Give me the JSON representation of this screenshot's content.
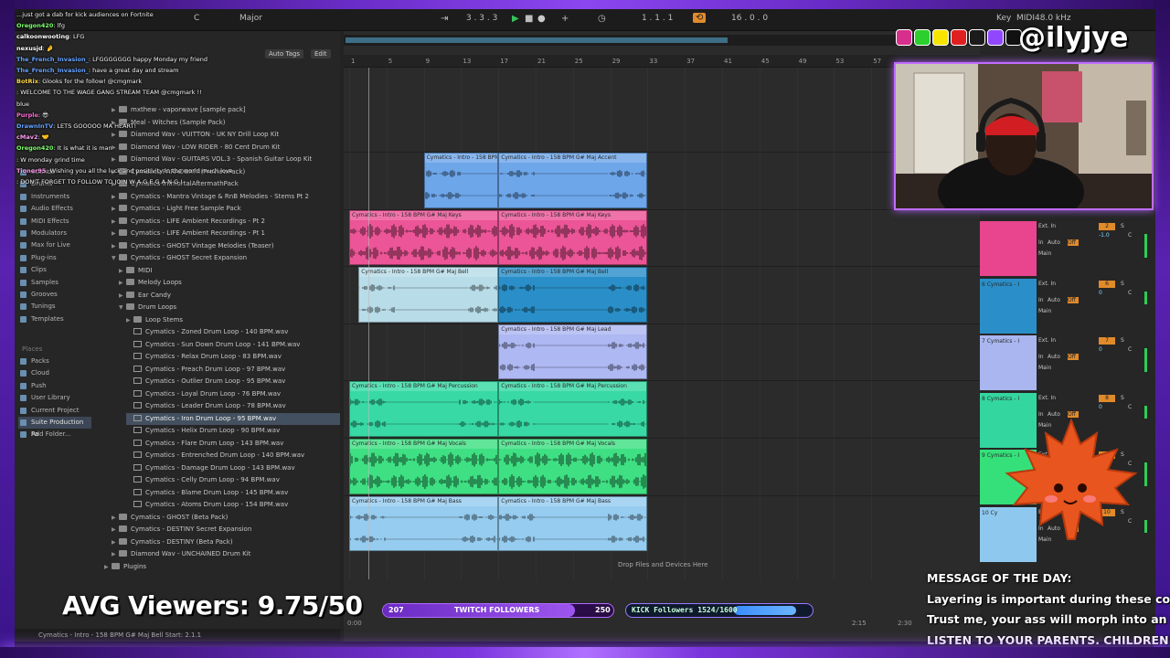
{
  "toolbar": {
    "scale_root": "C",
    "scale_mode": "Major",
    "position": "3 . 3 . 3",
    "loop_start": "1 . 1 . 1",
    "loop_length": "16 . 0 . 0",
    "key_label": "Key",
    "midi_label": "MIDI",
    "sample_rate": "48.0 kHz"
  },
  "browser": {
    "search_header": "Auto Tags",
    "edit_label": "Edit",
    "categories": [
      {
        "label": "Sounds",
        "icon": "speaker-icon"
      },
      {
        "label": "Drums",
        "icon": "drum-icon"
      },
      {
        "label": "Instruments",
        "icon": "keys-icon"
      },
      {
        "label": "Audio Effects",
        "icon": "fx-icon"
      },
      {
        "label": "MIDI Effects",
        "icon": "midi-icon"
      },
      {
        "label": "Modulators",
        "icon": "mod-icon"
      },
      {
        "label": "Max for Live",
        "icon": "max-icon"
      },
      {
        "label": "Plug-ins",
        "icon": "plug-icon"
      },
      {
        "label": "Clips",
        "icon": "clip-icon"
      },
      {
        "label": "Samples",
        "icon": "sample-icon"
      },
      {
        "label": "Grooves",
        "icon": "groove-icon"
      },
      {
        "label": "Tunings",
        "icon": "tuning-icon"
      },
      {
        "label": "Templates",
        "icon": "template-icon"
      }
    ],
    "places_label": "Places",
    "places": [
      {
        "label": "Packs",
        "selected": false
      },
      {
        "label": "Cloud",
        "selected": false
      },
      {
        "label": "Push",
        "selected": false
      },
      {
        "label": "User Library",
        "selected": false
      },
      {
        "label": "Current Project",
        "selected": false
      },
      {
        "label": "Suite Production Pa",
        "selected": true
      },
      {
        "label": "Add Folder...",
        "selected": false
      }
    ],
    "tree": [
      {
        "label": "mxthew - vaporwave [sample pack]",
        "kind": "folder",
        "indent": 0,
        "expanded": false
      },
      {
        "label": "Meal - Witches (Sample Pack)",
        "kind": "folder",
        "indent": 0,
        "expanded": false
      },
      {
        "label": "Diamond Wav - VUITTON - UK NY Drill Loop Kit",
        "kind": "folder",
        "indent": 0,
        "expanded": false
      },
      {
        "label": "Diamond Wav - LOW RIDER - 80 Cent Drum Kit",
        "kind": "folder",
        "indent": 0,
        "expanded": false
      },
      {
        "label": "Diamond Wav - GUITARS VOL.3 - Spanish Guitar Loop Kit",
        "kind": "folder",
        "indent": 0,
        "expanded": false
      },
      {
        "label": "Cymatics-PARADOX!!!(PreviewPack)",
        "kind": "folder",
        "indent": 0,
        "expanded": false
      },
      {
        "label": "Cymatics-ImmortalAftermathPack",
        "kind": "folder",
        "indent": 0,
        "expanded": false
      },
      {
        "label": "Cymatics - Mantra Vintage & RnB Melodies - Stems Pt 2",
        "kind": "folder",
        "indent": 0,
        "expanded": false
      },
      {
        "label": "Cymatics - Light Free Sample Pack",
        "kind": "folder",
        "indent": 0,
        "expanded": false
      },
      {
        "label": "Cymatics - LIFE Ambient Recordings - Pt 2",
        "kind": "folder",
        "indent": 0,
        "expanded": false
      },
      {
        "label": "Cymatics - LIFE Ambient Recordings - Pt 1",
        "kind": "folder",
        "indent": 0,
        "expanded": false
      },
      {
        "label": "Cymatics - GHOST Vintage Melodies (Teaser)",
        "kind": "folder",
        "indent": 0,
        "expanded": false
      },
      {
        "label": "Cymatics - GHOST Secret Expansion",
        "kind": "folder",
        "indent": 0,
        "expanded": true
      },
      {
        "label": "MIDI",
        "kind": "folder",
        "indent": 1,
        "expanded": false
      },
      {
        "label": "Melody Loops",
        "kind": "folder",
        "indent": 1,
        "expanded": false
      },
      {
        "label": "Ear Candy",
        "kind": "folder",
        "indent": 1,
        "expanded": false
      },
      {
        "label": "Drum Loops",
        "kind": "folder",
        "indent": 1,
        "expanded": true
      },
      {
        "label": "Loop Stems",
        "kind": "folder",
        "indent": 2,
        "expanded": false
      },
      {
        "label": "Cymatics - Zoned Drum Loop - 140 BPM.wav",
        "kind": "file",
        "indent": 2,
        "selected": false
      },
      {
        "label": "Cymatics - Sun Down Drum Loop - 141 BPM.wav",
        "kind": "file",
        "indent": 2,
        "selected": false
      },
      {
        "label": "Cymatics - Relax Drum Loop - 83 BPM.wav",
        "kind": "file",
        "indent": 2,
        "selected": false
      },
      {
        "label": "Cymatics - Preach Drum Loop - 97 BPM.wav",
        "kind": "file",
        "indent": 2,
        "selected": false
      },
      {
        "label": "Cymatics - Outlier Drum Loop - 95 BPM.wav",
        "kind": "file",
        "indent": 2,
        "selected": false
      },
      {
        "label": "Cymatics - Loyal Drum Loop - 76 BPM.wav",
        "kind": "file",
        "indent": 2,
        "selected": false
      },
      {
        "label": "Cymatics - Leader Drum Loop - 78 BPM.wav",
        "kind": "file",
        "indent": 2,
        "selected": false
      },
      {
        "label": "Cymatics - Iron Drum Loop - 95 BPM.wav",
        "kind": "file",
        "indent": 2,
        "selected": true
      },
      {
        "label": "Cymatics - Helix Drum Loop - 90 BPM.wav",
        "kind": "file",
        "indent": 2,
        "selected": false
      },
      {
        "label": "Cymatics - Flare Drum Loop - 143 BPM.wav",
        "kind": "file",
        "indent": 2,
        "selected": false
      },
      {
        "label": "Cymatics - Entrenched Drum Loop - 140 BPM.wav",
        "kind": "file",
        "indent": 2,
        "selected": false
      },
      {
        "label": "Cymatics - Damage Drum Loop - 143 BPM.wav",
        "kind": "file",
        "indent": 2,
        "selected": false
      },
      {
        "label": "Cymatics - Celly Drum Loop - 94 BPM.wav",
        "kind": "file",
        "indent": 2,
        "selected": false
      },
      {
        "label": "Cymatics - Blame Drum Loop - 145 BPM.wav",
        "kind": "file",
        "indent": 2,
        "selected": false
      },
      {
        "label": "Cymatics - Atoms Drum Loop - 154 BPM.wav",
        "kind": "file",
        "indent": 2,
        "selected": false
      },
      {
        "label": "Cymatics - GHOST (Beta Pack)",
        "kind": "folder",
        "indent": 0,
        "expanded": false
      },
      {
        "label": "Cymatics - DESTINY Secret Expansion",
        "kind": "folder",
        "indent": 0,
        "expanded": false
      },
      {
        "label": "Cymatics - DESTINY (Beta Pack)",
        "kind": "folder",
        "indent": 0,
        "expanded": false
      },
      {
        "label": "Diamond Wav - UNCHAINED Drum Kit",
        "kind": "folder",
        "indent": 0,
        "expanded": false
      },
      {
        "label": "Plugins",
        "kind": "folder",
        "indent": -1,
        "expanded": false
      }
    ],
    "status": "Cymatics - Intro - 158 BPM G# Maj Bell  Start: 2.1.1"
  },
  "arrangement": {
    "bar_numbers": [
      "1",
      "5",
      "9",
      "13",
      "17",
      "21",
      "25",
      "29",
      "33",
      "37",
      "41",
      "45",
      "49",
      "53",
      "57"
    ],
    "drop_hint": "Drop Files and Devices Here",
    "time_end": "2:15",
    "time_mid": "2:30",
    "time_start": "0:00",
    "tracks": [
      {
        "color": "#5d9ee0",
        "clips": [
          {
            "label": "Cymatics - Intro - 158 BPM G# Maj Accent",
            "color": "#6ea6ea",
            "start": 9,
            "end": 17
          },
          {
            "label": "Cymatics - Intro - 158 BPM G# Maj Accent",
            "color": "#6ea6ea",
            "start": 17,
            "end": 33
          }
        ]
      },
      {
        "color": "#e8458e",
        "clips": [
          {
            "label": "Cymatics - Intro - 158 BPM G# Maj Keys",
            "color": "#ec5597",
            "start": 1,
            "end": 17
          },
          {
            "label": "Cymatics - Intro - 158 BPM G# Maj Keys",
            "color": "#ec5597",
            "start": 17,
            "end": 33
          }
        ]
      },
      {
        "color": "#2a8fc8",
        "clips": [
          {
            "label": "Cymatics - Intro - 158 BPM G# Maj Bell",
            "color": "#b8dce8",
            "start": 2,
            "end": 17
          },
          {
            "label": "Cymatics - Intro - 158 BPM G# Maj Bell",
            "color": "#2a8fc8",
            "start": 17,
            "end": 33
          }
        ]
      },
      {
        "color": "#a9b6f0",
        "clips": [
          {
            "label": "Cymatics - Intro - 158 BPM G# Maj Lead",
            "color": "#aeb8f2",
            "start": 17,
            "end": 33
          }
        ]
      },
      {
        "color": "#34d6a0",
        "clips": [
          {
            "label": "Cymatics - Intro - 158 BPM G# Maj Percussion",
            "color": "#38d9a4",
            "start": 1,
            "end": 17
          },
          {
            "label": "Cymatics - Intro - 158 BPM G# Maj Percussion",
            "color": "#38d9a4",
            "start": 17,
            "end": 33
          }
        ]
      },
      {
        "color": "#35e07a",
        "clips": [
          {
            "label": "Cymatics - Intro - 158 BPM G# Maj Vocals",
            "color": "#3fe083",
            "start": 1,
            "end": 17
          },
          {
            "label": "Cymatics - Intro - 158 BPM G# Maj Vocals",
            "color": "#3fe083",
            "start": 17,
            "end": 33
          }
        ]
      },
      {
        "color": "#8fc8ee",
        "clips": [
          {
            "label": "Cymatics - Intro - 158 BPM G# Maj Bass",
            "color": "#96ccef",
            "start": 1,
            "end": 17
          },
          {
            "label": "Cymatics - Intro - 158 BPM G# Maj Bass",
            "color": "#96ccef",
            "start": 17,
            "end": 33
          }
        ]
      }
    ]
  },
  "mixer": {
    "tracks": [
      {
        "name": "",
        "number": "2",
        "color": "#e8458e",
        "input": "Ext. In",
        "output": "Main",
        "vol": "-1.0",
        "pan": "C"
      },
      {
        "name": "6 Cymatics - I",
        "number": "6",
        "color": "#2a8fc8",
        "input": "Ext. In",
        "output": "Main",
        "vol": "0",
        "pan": "C"
      },
      {
        "name": "7 Cymatics - I",
        "number": "7",
        "color": "#a9b6f0",
        "input": "Ext. In",
        "output": "Main",
        "vol": "0",
        "pan": "C"
      },
      {
        "name": "8 Cymatics - I",
        "number": "8",
        "color": "#34d6a0",
        "input": "Ext. In",
        "output": "Main",
        "vol": "0",
        "pan": "C"
      },
      {
        "name": "9 Cymatics - I",
        "number": "9",
        "color": "#35e07a",
        "input": "Ext. In",
        "output": "Main",
        "vol": "-6.0",
        "pan": "C"
      },
      {
        "name": "10 Cy",
        "number": "10",
        "color": "#8fc8ee",
        "input": "Ext. In",
        "output": "Main",
        "vol": "0",
        "pan": "C"
      }
    ],
    "auto_label": "Auto",
    "off_label": "Off",
    "in_label": "In",
    "solo": "S"
  },
  "chat": [
    {
      "user": "",
      "color": "#ffffff",
      "text": "...just got a dab for kick audiences on Fortnite"
    },
    {
      "user": "Oregon420",
      "color": "#7cff6b",
      "text": ": lfg"
    },
    {
      "user": "calkoonwooting",
      "color": "#ffffff",
      "text": ": LFG"
    },
    {
      "user": "nexusjd",
      "color": "#ffffff",
      "text": ": 🤌"
    },
    {
      "user": "The_French_Invasion_",
      "color": "#66a3ff",
      "text": ": LFGGGGGGG happy Monday my friend"
    },
    {
      "user": "The_French_Invasion_",
      "color": "#66a3ff",
      "text": ": have a great day and stream"
    },
    {
      "user": "BotRix",
      "color": "#ffd84a",
      "text": ": Glooks for the follow! @cmgmark"
    },
    {
      "user": "",
      "color": "#ff4d4d",
      "text": ": WELCOME TO THE WAGE GANG STREAM TEAM @cmgmark !!"
    },
    {
      "user": "",
      "color": "#7cff6b",
      "text": "blue"
    },
    {
      "user": "Purple",
      "color": "#ff6bd6",
      "text": ": 😎"
    },
    {
      "user": "DrawnInTV",
      "color": "#66a3ff",
      "text": ": LETS GOOOOO MA HEART!"
    },
    {
      "user": "cMav2",
      "color": "#ff9bf0",
      "text": ": 🤝"
    },
    {
      "user": "Oregon420",
      "color": "#7cff6b",
      "text": ": It is what it is man"
    },
    {
      "user": "",
      "color": "#ff4d4d",
      "text": ": W monday grind time"
    },
    {
      "user": "Tioner95",
      "color": "#ff9bf0",
      "text": ": Wishing you all the luck and positivity in the world much love"
    },
    {
      "user": "",
      "color": "#ff4d4d",
      "text": ": DON'T FORGET TO FOLLOW TO JOIN W A G E G A N G !"
    }
  ],
  "socials": {
    "handle": "@ilyjye",
    "icons": [
      "instagram-icon",
      "kick-icon",
      "snapchat-icon",
      "youtube-icon",
      "tiktok-icon",
      "twitch-icon",
      "x-icon"
    ]
  },
  "overlay": {
    "viewers": "AVG Viewers: 9.75/50",
    "twitch": {
      "current": "207",
      "label": "TWITCH FOLLOWERS",
      "goal": "250",
      "progress": 0.828
    },
    "kick": {
      "label": "KICK Followers 1524/1600",
      "progress": 0.9525
    },
    "motd": [
      "MESSAGE OF THE DAY:",
      "Layering is important during these cold times.",
      "Trust me, your ass will morph into an ice cube.",
      "LISTEN TO YOUR PARENTS. CHILDREN!"
    ]
  }
}
